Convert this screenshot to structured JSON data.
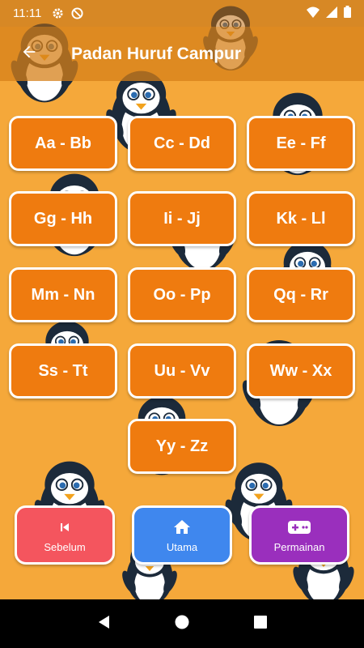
{
  "status_bar": {
    "time": "11:11",
    "icons": [
      "settings-icon",
      "no-disturb-icon",
      "wifi-icon",
      "signal-icon",
      "battery-icon"
    ]
  },
  "app_bar": {
    "title": "Padan Huruf Campur",
    "back_icon": "arrow-left-icon"
  },
  "letter_pairs": [
    "Aa - Bb",
    "Cc - Dd",
    "Ee - Ff",
    "Gg - Hh",
    "Ii - Jj",
    "Kk - Ll",
    "Mm - Nn",
    "Oo - Pp",
    "Qq - Rr",
    "Ss - Tt",
    "Uu - Vv",
    "Ww - Xx",
    "Yy - Zz"
  ],
  "bottom_nav": {
    "previous": {
      "label": "Sebelum",
      "icon": "skip-previous-icon",
      "color": "#f4555e"
    },
    "home": {
      "label": "Utama",
      "icon": "home-icon",
      "color": "#3f87ee"
    },
    "games": {
      "label": "Permainan",
      "icon": "gamepad-icon",
      "color": "#9a2fbd"
    }
  },
  "colors": {
    "background": "#f5a83a",
    "tile": "#ef7b0f",
    "app_bar": "#d68019"
  }
}
